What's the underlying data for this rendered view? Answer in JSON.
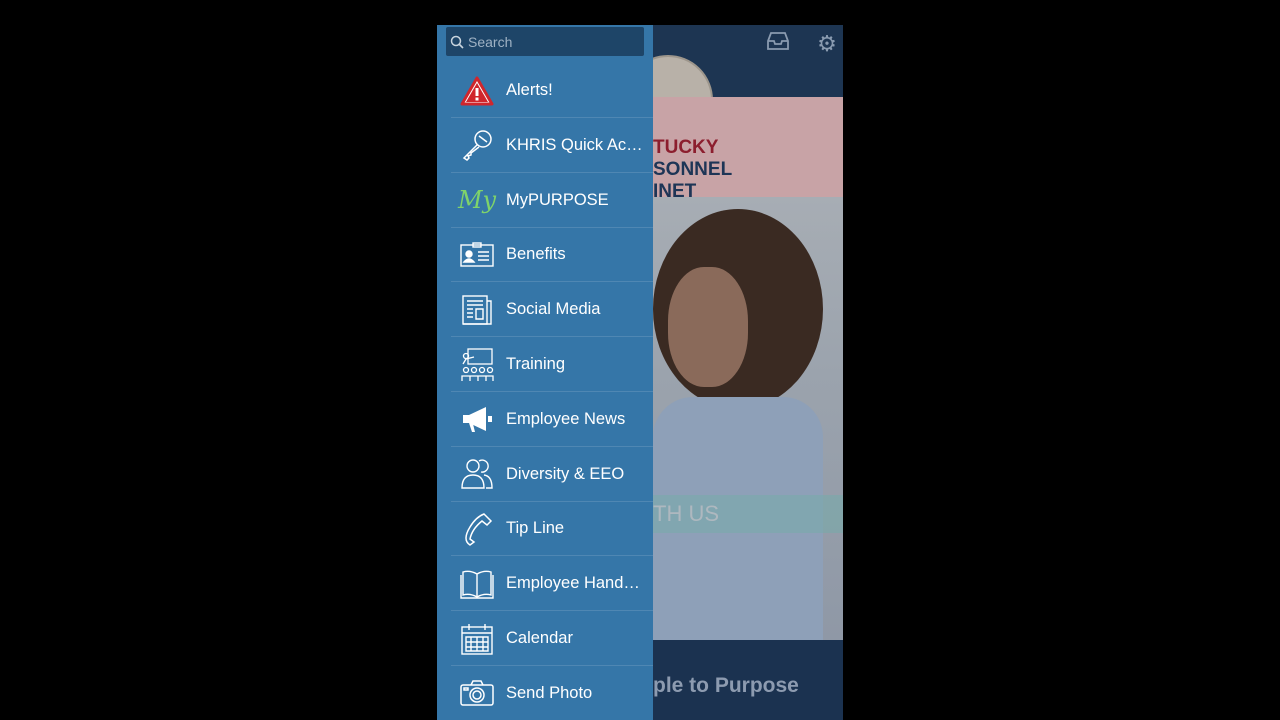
{
  "search": {
    "placeholder": "Search"
  },
  "menu": [
    {
      "label": "Alerts!",
      "icon": "warning-icon"
    },
    {
      "label": "KHRIS Quick Access",
      "icon": "key-icon"
    },
    {
      "label": "MyPURPOSE",
      "icon": "my-logo-icon",
      "icon_text": "My"
    },
    {
      "label": "Benefits",
      "icon": "id-card-icon"
    },
    {
      "label": "Social Media",
      "icon": "newspaper-icon"
    },
    {
      "label": "Training",
      "icon": "classroom-icon"
    },
    {
      "label": "Employee News",
      "icon": "megaphone-icon"
    },
    {
      "label": "Diversity & EEO",
      "icon": "people-icon"
    },
    {
      "label": "Tip Line",
      "icon": "phone-icon"
    },
    {
      "label": "Employee Handbook",
      "icon": "book-icon"
    },
    {
      "label": "Calendar",
      "icon": "calendar-icon"
    },
    {
      "label": "Send Photo",
      "icon": "camera-icon"
    }
  ],
  "background": {
    "logo_line1": "TUCKY",
    "logo_line2": "SONNEL",
    "logo_line3": "INET",
    "banner_text": "TH US",
    "footer_text": "ple to Purpose"
  },
  "colors": {
    "drawer": "#3576a8",
    "alert_red": "#d0262c",
    "my_green": "#7fd36a"
  }
}
